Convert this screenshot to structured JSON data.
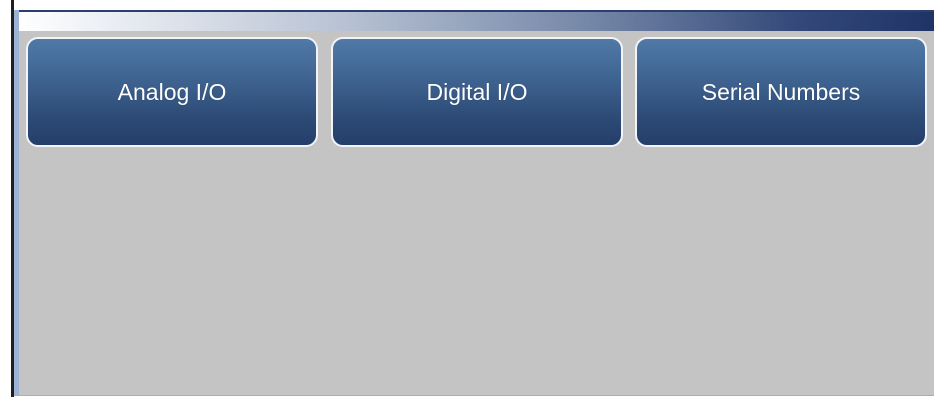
{
  "menu": {
    "buttons": [
      {
        "label": "Analog I/O"
      },
      {
        "label": "Digital I/O"
      },
      {
        "label": "Serial Numbers"
      }
    ]
  }
}
